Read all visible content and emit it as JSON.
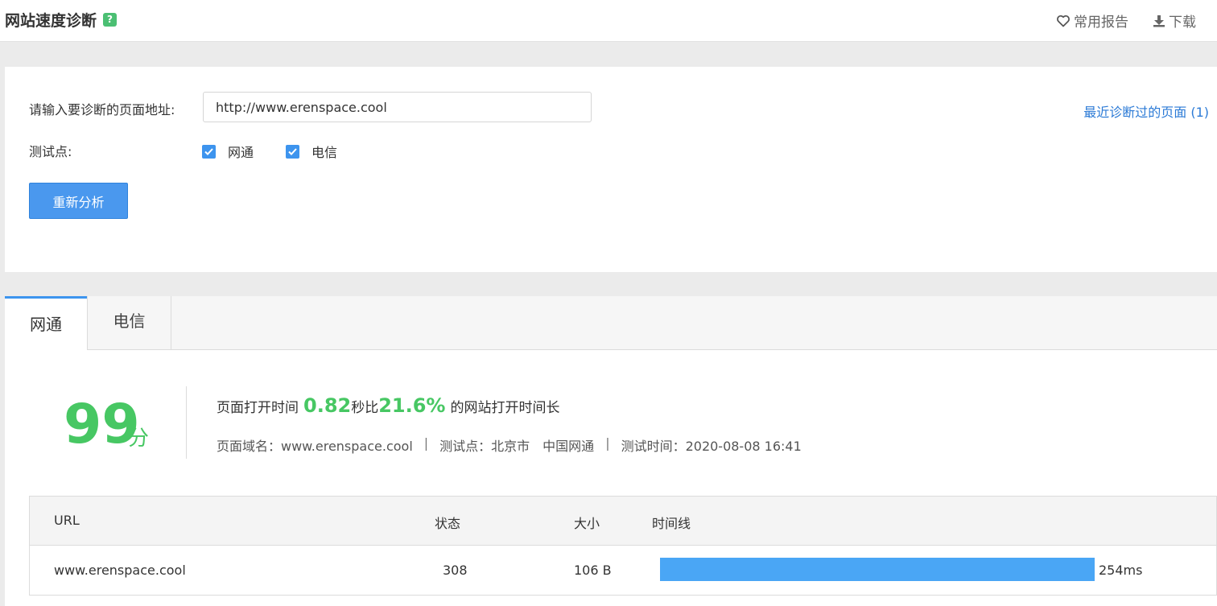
{
  "header": {
    "title": "网站速度诊断",
    "help_icon": "?",
    "favorites_label": "常用报告",
    "download_label": "下载"
  },
  "form": {
    "url_label": "请输入要诊断的页面地址:",
    "url_value": "http://www.erenspace.cool",
    "recent_link": "最近诊断过的页面 (1)",
    "test_points_label": "测试点:",
    "test_points": [
      {
        "label": "网通",
        "checked": true
      },
      {
        "label": "电信",
        "checked": true
      }
    ],
    "reanalyze_button": "重新分析"
  },
  "tabs": [
    {
      "label": "网通",
      "active": true
    },
    {
      "label": "电信",
      "active": false
    }
  ],
  "result": {
    "score": "99",
    "score_unit": "分",
    "summary_prefix": "页面打开时间",
    "load_time": "0.82",
    "summary_mid": "秒比",
    "percent": "21.6%",
    "summary_suffix": "的网站打开时间长",
    "domain": "页面域名：www.erenspace.cool",
    "test_point": "测试点：北京市　中国网通",
    "test_time": "测试时间：2020-08-08 16:41",
    "separator": "|",
    "score_color": "#47c763"
  },
  "table": {
    "columns": [
      "URL",
      "状态",
      "大小",
      "时间线"
    ],
    "rows": [
      {
        "url": "www.erenspace.cool",
        "status": "308",
        "size": "106 B",
        "time": "254ms",
        "timeline_fraction": 1.0
      }
    ],
    "bar_color": "#4aa6f5"
  }
}
